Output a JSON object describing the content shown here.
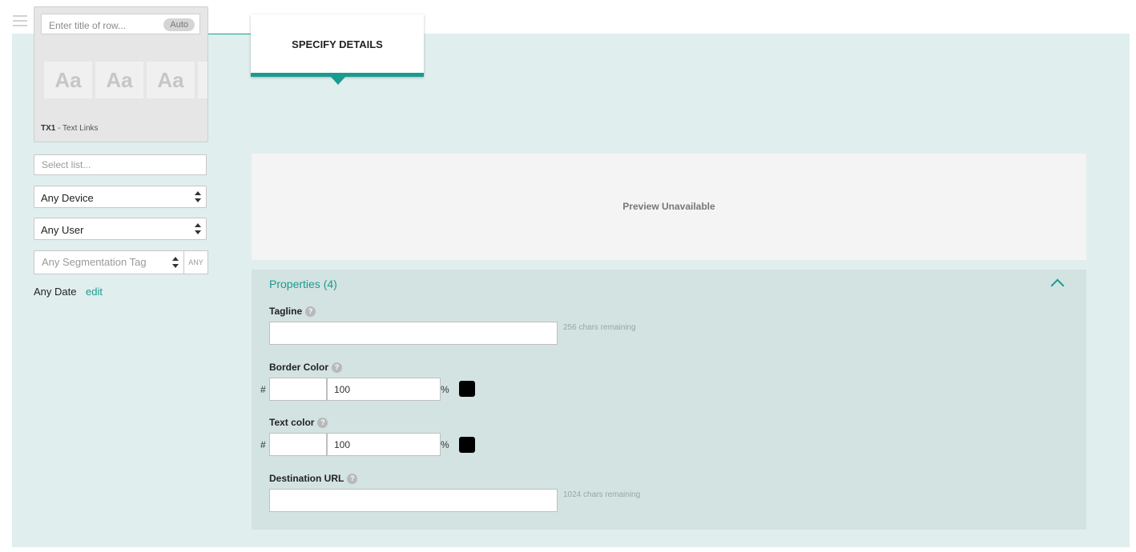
{
  "menu": {
    "icon": "hamburger-icon"
  },
  "row_config": {
    "title_placeholder": "Enter title of row...",
    "auto_label": "Auto",
    "template_samples": [
      "Aa",
      "Aa",
      "Aa"
    ],
    "template_code": "TX1",
    "template_name": "- Text Links"
  },
  "filters": {
    "list_placeholder": "Select list...",
    "device": "Any Device",
    "user": "Any User",
    "segmentation_tag": "Any Segmentation Tag",
    "any_label": "ANY",
    "date_label": "Any Date",
    "edit_label": "edit"
  },
  "tab": {
    "label": "SPECIFY DETAILS"
  },
  "preview": {
    "message": "Preview Unavailable"
  },
  "properties": {
    "title": "Properties (4)",
    "help_glyph": "?",
    "tagline": {
      "label": "Tagline",
      "value": "",
      "remaining": "256 chars remaining"
    },
    "border_color": {
      "label": "Border Color",
      "hash": "#",
      "hex": "",
      "opacity": "100",
      "percent": "%",
      "swatch": "#000000"
    },
    "text_color": {
      "label": "Text color",
      "hash": "#",
      "hex": "",
      "opacity": "100",
      "percent": "%",
      "swatch": "#000000"
    },
    "destination_url": {
      "label": "Destination URL",
      "value": "",
      "remaining": "1024 chars remaining"
    }
  },
  "colors": {
    "accent": "#1a9b8f",
    "canvas": "#e0eeee",
    "properties_bg": "#d3e3e2"
  }
}
